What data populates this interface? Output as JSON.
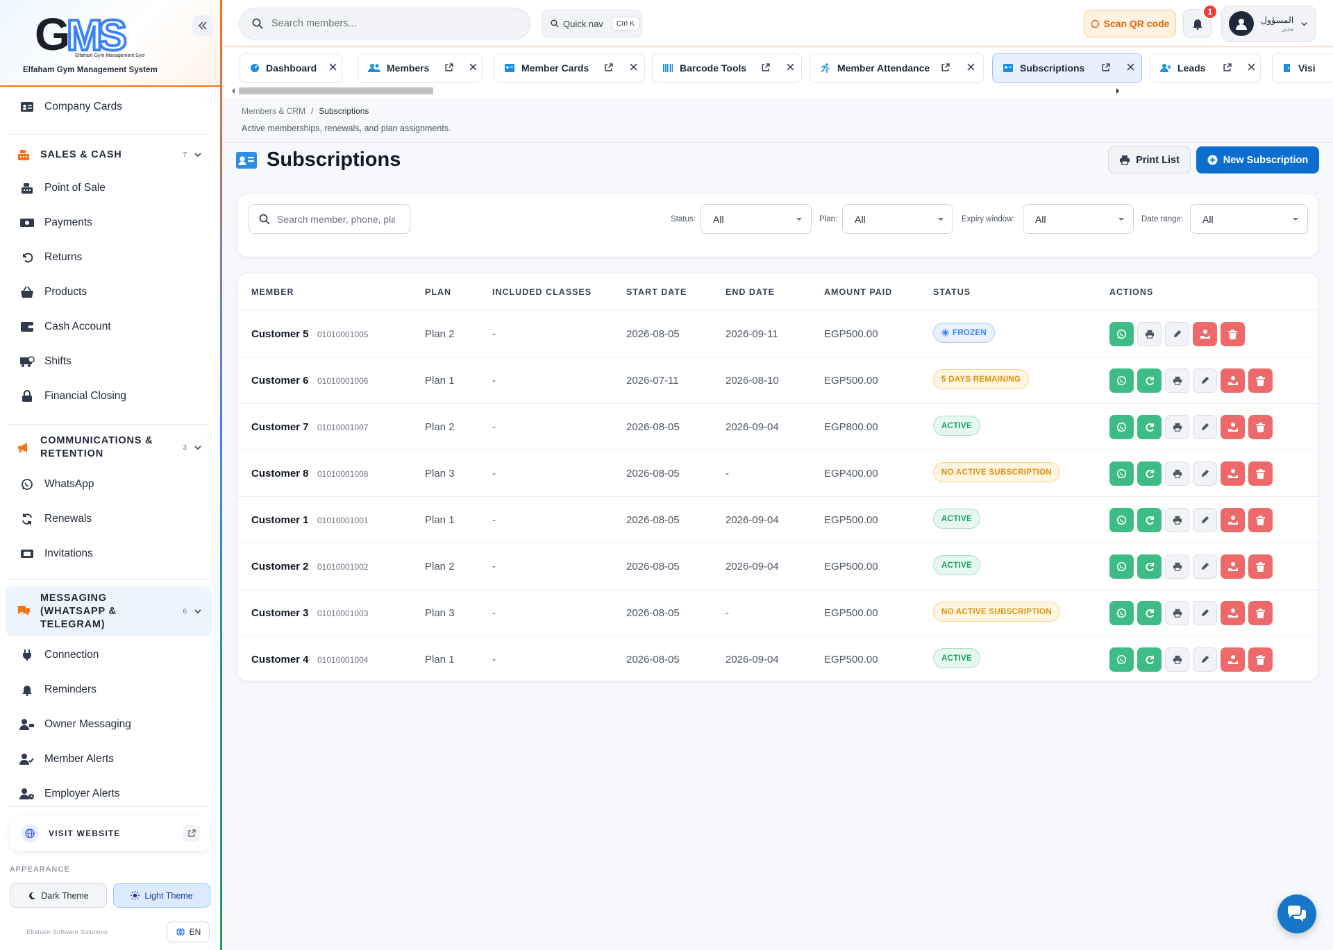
{
  "app": {
    "logo_text": "GMS",
    "logo_subtext": "Elfaham Gym Management System",
    "name": "Elfaham Gym Management System"
  },
  "sidebar": {
    "top_item": {
      "label": "Company Cards",
      "icon": "id-card-icon"
    },
    "sections": [
      {
        "title": "SALES & CASH",
        "count": "7",
        "color": "#f97316",
        "items": [
          {
            "label": "Point of Sale",
            "icon": "cash-register-icon"
          },
          {
            "label": "Payments",
            "icon": "money-bill-icon"
          },
          {
            "label": "Returns",
            "icon": "undo-icon"
          },
          {
            "label": "Products",
            "icon": "basket-icon"
          },
          {
            "label": "Cash Account",
            "icon": "wallet-icon"
          },
          {
            "label": "Shifts",
            "icon": "truck-clock-icon"
          },
          {
            "label": "Financial Closing",
            "icon": "lock-icon"
          }
        ]
      },
      {
        "title": "COMMUNICATIONS & RETENTION",
        "count": "3",
        "color": "#f97316",
        "items": [
          {
            "label": "WhatsApp",
            "icon": "whatsapp-icon"
          },
          {
            "label": "Renewals",
            "icon": "sync-icon"
          },
          {
            "label": "Invitations",
            "icon": "ticket-icon"
          }
        ]
      },
      {
        "title": "MESSAGING (WHATSAPP & TELEGRAM)",
        "count": "6",
        "color": "#f97316",
        "items": [
          {
            "label": "Connection",
            "icon": "plug-icon"
          },
          {
            "label": "Reminders",
            "icon": "bell-icon"
          },
          {
            "label": "Owner Messaging",
            "icon": "user-chat-icon"
          },
          {
            "label": "Member Alerts",
            "icon": "user-check-icon"
          },
          {
            "label": "Employer Alerts",
            "icon": "user-clock-icon"
          }
        ]
      }
    ],
    "visit_website": "VISIT WEBSITE",
    "appearance_label": "APPEARANCE",
    "dark_theme": "Dark Theme",
    "light_theme": "Light Theme",
    "footer_brand": "Elfaham Software Solutions",
    "language": "EN"
  },
  "topbar": {
    "search_placeholder": "Search members...",
    "quick_nav": "Quick nav",
    "quick_nav_shortcut": "Ctrl K",
    "scan_qr": "Scan QR code",
    "notifications_count": "1",
    "user_name": "المسؤول",
    "user_role": "مدير"
  },
  "tabs": [
    {
      "label": "Dashboard",
      "icon": "dashboard-icon"
    },
    {
      "label": "Members",
      "icon": "users-icon"
    },
    {
      "label": "Member Cards",
      "icon": "id-card-icon"
    },
    {
      "label": "Barcode Tools",
      "icon": "barcode-icon"
    },
    {
      "label": "Member Attendance",
      "icon": "running-icon"
    },
    {
      "label": "Subscriptions",
      "icon": "id-card-icon",
      "active": true
    },
    {
      "label": "Leads",
      "icon": "user-plus-icon"
    },
    {
      "label": "Visi",
      "icon": "door-icon"
    }
  ],
  "breadcrumb": {
    "parent": "Members & CRM",
    "separator": "/",
    "current": "Subscriptions"
  },
  "page": {
    "description": "Active memberships, renewals, and plan assignments.",
    "title": "Subscriptions",
    "print_list": "Print List",
    "new_subscription": "New Subscription"
  },
  "filters": {
    "search_placeholder": "Search member, phone, plan...",
    "status_label": "Status:",
    "status_value": "All",
    "plan_label": "Plan:",
    "plan_value": "All",
    "expiry_label": "Expiry window:",
    "expiry_value": "All",
    "date_label": "Date range:",
    "date_value": "All"
  },
  "table": {
    "headers": [
      "MEMBER",
      "PLAN",
      "INCLUDED CLASSES",
      "START DATE",
      "END DATE",
      "AMOUNT PAID",
      "STATUS",
      "ACTIONS"
    ],
    "rows": [
      {
        "name": "Customer 5",
        "phone": "01010001005",
        "plan": "Plan 2",
        "classes": "-",
        "start": "2026-08-05",
        "end": "2026-09-11",
        "amount": "EGP500.00",
        "status": "FROZEN",
        "status_type": "frozen",
        "renew": false
      },
      {
        "name": "Customer 6",
        "phone": "01010001006",
        "plan": "Plan 1",
        "classes": "-",
        "start": "2026-07-11",
        "end": "2026-08-10",
        "amount": "EGP500.00",
        "status": "5 DAYS REMAINING",
        "status_type": "remaining",
        "renew": true
      },
      {
        "name": "Customer 7",
        "phone": "01010001007",
        "plan": "Plan 2",
        "classes": "-",
        "start": "2026-08-05",
        "end": "2026-09-04",
        "amount": "EGP800.00",
        "status": "ACTIVE",
        "status_type": "active",
        "renew": true
      },
      {
        "name": "Customer 8",
        "phone": "01010001008",
        "plan": "Plan 3",
        "classes": "-",
        "start": "2026-08-05",
        "end": "-",
        "amount": "EGP400.00",
        "status": "NO ACTIVE SUBSCRIPTION",
        "status_type": "none",
        "renew": true
      },
      {
        "name": "Customer 1",
        "phone": "01010001001",
        "plan": "Plan 1",
        "classes": "-",
        "start": "2026-08-05",
        "end": "2026-09-04",
        "amount": "EGP500.00",
        "status": "ACTIVE",
        "status_type": "active",
        "renew": true
      },
      {
        "name": "Customer 2",
        "phone": "01010001002",
        "plan": "Plan 2",
        "classes": "-",
        "start": "2026-08-05",
        "end": "2026-09-04",
        "amount": "EGP500.00",
        "status": "ACTIVE",
        "status_type": "active",
        "renew": true
      },
      {
        "name": "Customer 3",
        "phone": "01010001003",
        "plan": "Plan 3",
        "classes": "-",
        "start": "2026-08-05",
        "end": "-",
        "amount": "EGP500.00",
        "status": "NO ACTIVE SUBSCRIPTION",
        "status_type": "none",
        "renew": true
      },
      {
        "name": "Customer 4",
        "phone": "01010001004",
        "plan": "Plan 1",
        "classes": "-",
        "start": "2026-08-05",
        "end": "2026-09-04",
        "amount": "EGP500.00",
        "status": "ACTIVE",
        "status_type": "active",
        "renew": true
      }
    ]
  },
  "colors": {
    "accent": "#0d6ecf",
    "brand_orange": "#f97316",
    "success": "#3dbd85",
    "danger": "#ee6a6a"
  }
}
